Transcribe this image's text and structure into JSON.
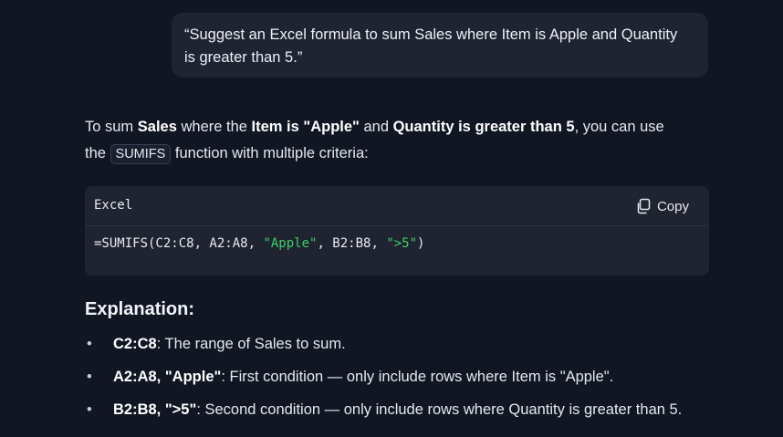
{
  "user_message": {
    "line1": "“Suggest an Excel formula to sum Sales where Item is Apple and Quantity",
    "line2": "is greater than 5.”"
  },
  "answer": {
    "p1": "To sum ",
    "b1": "Sales",
    "p2": " where the ",
    "b2": "Item is \"Apple\"",
    "p3": " and ",
    "b3": "Quantity is greater than 5",
    "p4": ", you can use",
    "p5": "the ",
    "inline_code": "SUMIFS",
    "p6": " function with multiple criteria:"
  },
  "code_block": {
    "language": "Excel",
    "copy_label": "Copy",
    "code_prefix": "=SUMIFS(C2:C8, A2:A8, ",
    "code_str1": "\"Apple\"",
    "code_mid": ", B2:B8, ",
    "code_str2": "\">5\"",
    "code_suffix": ")"
  },
  "explanation": {
    "title": "Explanation:",
    "bullets": [
      {
        "bold": "C2:C8",
        "text": ": The range of Sales to sum."
      },
      {
        "bold": "A2:A8, \"Apple\"",
        "text": ": First condition — only include rows where Item is \"Apple\"."
      },
      {
        "bold": "B2:B8, \">5\"",
        "text": ": Second condition — only include rows where Quantity is greater than 5."
      }
    ]
  },
  "colors": {
    "background": "#111623",
    "bubble": "#1f2432",
    "code_bg": "#1f2430",
    "string": "#3ecf6b"
  }
}
